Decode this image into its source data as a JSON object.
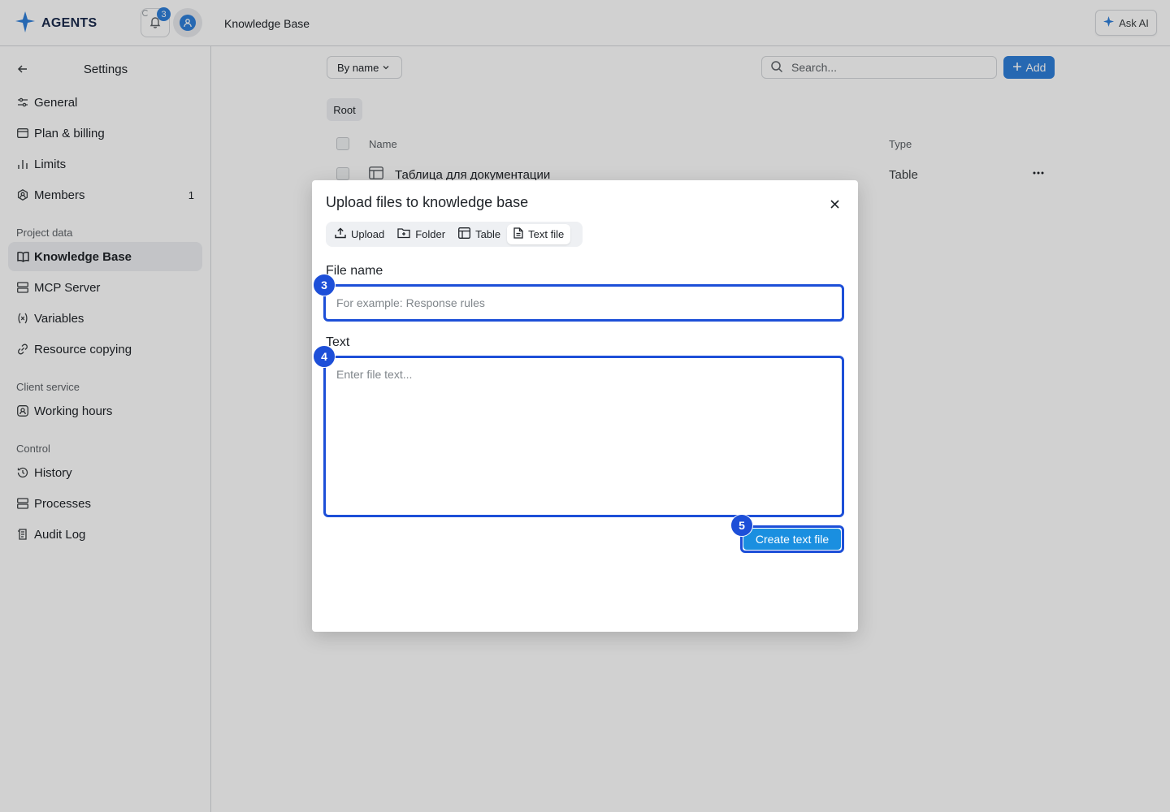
{
  "brand": {
    "name": "AGENTS",
    "logo_icon": "star-logo-icon",
    "accent": "#2f7fd9"
  },
  "topbar": {
    "notifications_count": "3",
    "page_title": "Knowledge Base",
    "ask_ai_label": "Ask AI"
  },
  "sidebar": {
    "settings_title": "Settings",
    "items_general": [
      {
        "label": "General",
        "icon": "sliders-icon"
      },
      {
        "label": "Plan & billing",
        "icon": "card-icon"
      },
      {
        "label": "Limits",
        "icon": "chart-icon"
      },
      {
        "label": "Members",
        "icon": "members-icon",
        "count": "1"
      }
    ],
    "section_project": "Project data",
    "items_project": [
      {
        "label": "Knowledge Base",
        "icon": "book-icon",
        "active": true
      },
      {
        "label": "MCP Server",
        "icon": "server-icon"
      },
      {
        "label": "Variables",
        "icon": "variable-icon"
      },
      {
        "label": "Resource copying",
        "icon": "link-icon"
      }
    ],
    "section_client": "Client service",
    "items_client": [
      {
        "label": "Working hours",
        "icon": "clock-badge-icon"
      }
    ],
    "section_control": "Control",
    "items_control": [
      {
        "label": "History",
        "icon": "history-icon"
      },
      {
        "label": "Processes",
        "icon": "server-icon"
      },
      {
        "label": "Audit Log",
        "icon": "audit-icon"
      }
    ]
  },
  "main": {
    "sort_label": "By name",
    "search_placeholder": "Search...",
    "add_label": "Add",
    "breadcrumb": "Root",
    "table": {
      "headers": {
        "name": "Name",
        "type": "Type"
      },
      "rows": [
        {
          "name": "Таблица для документации",
          "type": "Table",
          "icon": "table-icon"
        }
      ]
    }
  },
  "modal": {
    "title": "Upload files to knowledge base",
    "tabs": [
      {
        "label": "Upload",
        "icon": "upload-icon"
      },
      {
        "label": "Folder",
        "icon": "folder-plus-icon"
      },
      {
        "label": "Table",
        "icon": "table-icon"
      },
      {
        "label": "Text file",
        "icon": "file-text-icon",
        "active": true
      }
    ],
    "file_name_label": "File name",
    "file_name_placeholder": "For example: Response rules",
    "file_name_value": "",
    "text_label": "Text",
    "text_placeholder": "Enter file text...",
    "text_value": "",
    "create_button": "Create text file",
    "markers": [
      "3",
      "4",
      "5"
    ],
    "marker_color": "#1d4fd8"
  }
}
